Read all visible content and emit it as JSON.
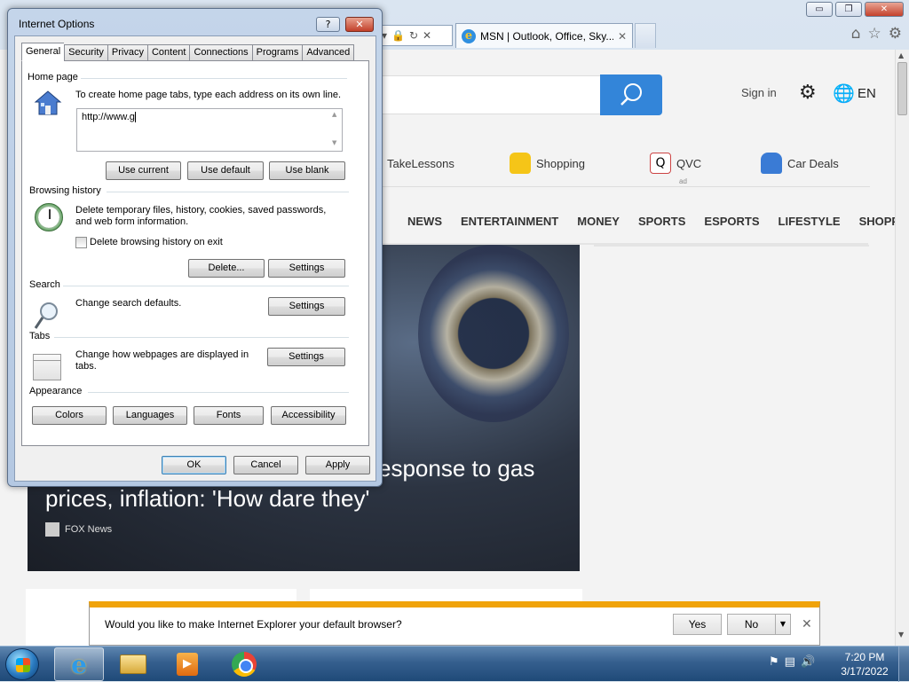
{
  "browser": {
    "window_controls": {
      "minimize": "▭",
      "maximize": "❐",
      "close": "✕"
    },
    "tab": {
      "title": "MSN | Outlook, Office, Sky...",
      "icon": "ie-icon"
    },
    "address_tail_icons": [
      "dropdown-icon",
      "lock-icon",
      "refresh-icon",
      "close-icon"
    ]
  },
  "msn": {
    "signin": "Sign in",
    "language": "EN",
    "quicklinks": [
      {
        "label": "TakeLessons"
      },
      {
        "label": "Shopping"
      },
      {
        "label": "QVC",
        "sub": "ad"
      },
      {
        "label": "Car Deals"
      }
    ],
    "nav": [
      "NEWS",
      "ENTERTAINMENT",
      "MONEY",
      "SPORTS",
      "ESPORTS",
      "LIFESTYLE",
      "SHOPP"
    ],
    "hero": {
      "title_line1": "esponse to gas",
      "title_line2": "prices, inflation: 'How dare they'",
      "source": "FOX News"
    }
  },
  "notification": {
    "text": "Would you like to make Internet Explorer your default browser?",
    "yes": "Yes",
    "no": "No"
  },
  "dialog": {
    "title": "Internet Options",
    "help": "?",
    "close": "✕",
    "tabs": [
      "General",
      "Security",
      "Privacy",
      "Content",
      "Connections",
      "Programs",
      "Advanced"
    ],
    "home_page": {
      "label": "Home page",
      "desc": "To create home page tabs, type each address on its own line.",
      "value": "http://www.g",
      "use_current": "Use current",
      "use_default": "Use default",
      "use_blank": "Use blank"
    },
    "browsing_history": {
      "label": "Browsing history",
      "desc_line1": "Delete temporary files, history, cookies, saved passwords,",
      "desc_line2": "and web form information.",
      "checkbox": "Delete browsing history on exit",
      "delete": "Delete...",
      "settings": "Settings"
    },
    "search": {
      "label": "Search",
      "desc": "Change search defaults.",
      "settings": "Settings"
    },
    "tabs_section": {
      "label": "Tabs",
      "desc_line1": "Change how webpages are displayed in",
      "desc_line2": "tabs.",
      "settings": "Settings"
    },
    "appearance": {
      "label": "Appearance",
      "colors": "Colors",
      "languages": "Languages",
      "fonts": "Fonts",
      "accessibility": "Accessibility"
    },
    "ok": "OK",
    "cancel": "Cancel",
    "apply": "Apply"
  },
  "taskbar": {
    "items": [
      "internet-explorer",
      "windows-explorer",
      "media-player",
      "google-chrome"
    ],
    "clock_time": "7:20 PM",
    "clock_date": "3/17/2022"
  },
  "colors": {
    "accent": "#3385d9",
    "notification_bar": "#f0a30a",
    "taskbar": "#355f8e"
  }
}
